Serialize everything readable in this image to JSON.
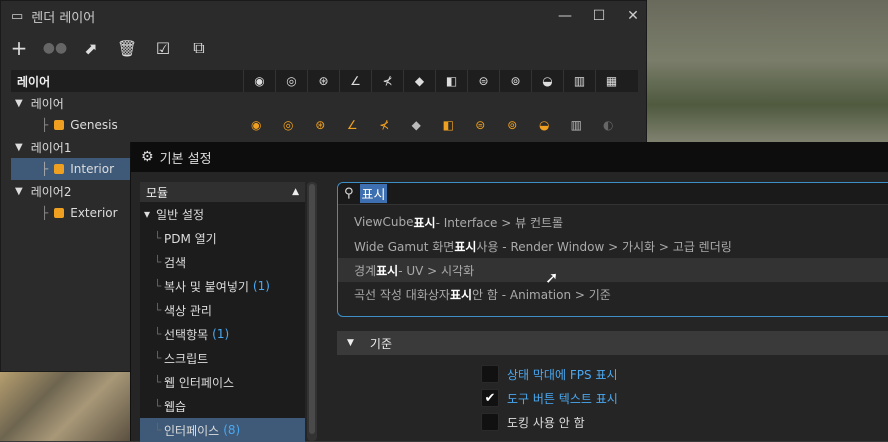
{
  "layer_window": {
    "title": "렌더 레이어",
    "header_label": "레이어",
    "column_icons": [
      "eye-icon",
      "eye-search-icon",
      "eye-gear-icon",
      "angle-icon",
      "angle-strike-icon",
      "cube-icon",
      "cube-shade-icon",
      "strike-eye-icon",
      "eye-gear2-icon",
      "hat-icon",
      "bars-icon",
      "grid-bars-icon"
    ],
    "rows": [
      {
        "label": "레이어",
        "indent": 0,
        "kind": "group"
      },
      {
        "label": "Genesis",
        "indent": 1,
        "kind": "item"
      },
      {
        "label": "레이어1",
        "indent": 0,
        "kind": "group"
      },
      {
        "label": "Interior",
        "indent": 1,
        "kind": "item",
        "selected": true
      },
      {
        "label": "레이어2",
        "indent": 0,
        "kind": "group"
      },
      {
        "label": "Exterior",
        "indent": 1,
        "kind": "item"
      }
    ]
  },
  "prefs": {
    "title": "기본 설정",
    "modules_header": "모듈",
    "modules": [
      {
        "label": "일반 설정",
        "expand": true
      },
      {
        "label": "PDM 열기"
      },
      {
        "label": "검색"
      },
      {
        "label": "복사 및 붙여넣기",
        "count": "(1)"
      },
      {
        "label": "색상 관리"
      },
      {
        "label": "선택항목",
        "count": "(1)"
      },
      {
        "label": "스크립트"
      },
      {
        "label": "웹 인터페이스"
      },
      {
        "label": "웹습"
      },
      {
        "label": "인터페이스",
        "count": "(8)",
        "selected": true
      }
    ],
    "search_value": "표시",
    "suggestions": [
      {
        "pre": "ViewCube ",
        "bold": "표시",
        "post": " - Interface > 뷰 컨트롤"
      },
      {
        "pre": "Wide Gamut 화면",
        "bold": "표시",
        "post": " 사용 - Render Window > 가시화 > 고급 렌더링"
      },
      {
        "pre": "경계 ",
        "bold": "표시",
        "post": " - UV > 시각화"
      },
      {
        "pre": "곡선 작성 대화상자 ",
        "bold": "표시",
        "post": " 안 함 - Animation > 기준"
      }
    ],
    "section_label": "기준",
    "checkboxes": [
      {
        "label": "상태 막대에 FPS 표시",
        "checked": false,
        "highlight": true
      },
      {
        "label": "도구 버튼 텍스트 표시",
        "checked": true,
        "highlight": true
      },
      {
        "label": "도킹 사용 안 함",
        "checked": false,
        "highlight": false
      }
    ]
  }
}
